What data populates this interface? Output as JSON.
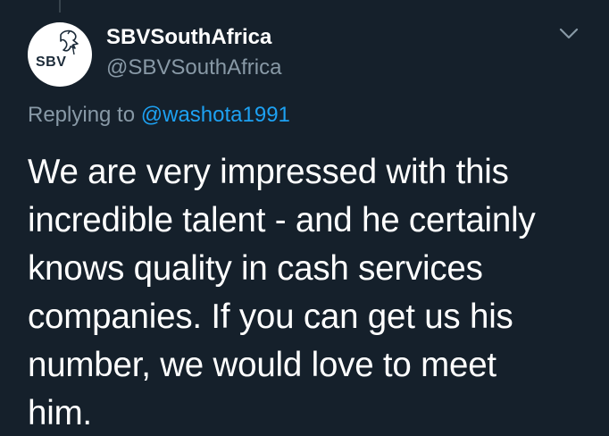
{
  "account": {
    "display_name": "SBVSouthAfrica",
    "handle": "@SBVSouthAfrica",
    "avatar_text": "SBV",
    "avatar_icon": "rhino-logo-icon"
  },
  "reply": {
    "prefix": "Replying to ",
    "mention": "@washota1991"
  },
  "tweet": {
    "text": "We are very impressed with this\nincredible  talent - and he certainly\nknows quality in cash services\ncompanies. If you can get us his\nnumber, we would love to meet\nhim."
  },
  "menu": {
    "icon": "chevron-down-icon"
  },
  "colors": {
    "background": "#15202b",
    "primary_text": "#ffffff",
    "secondary_text": "#8899a6",
    "link": "#1da1f2"
  }
}
